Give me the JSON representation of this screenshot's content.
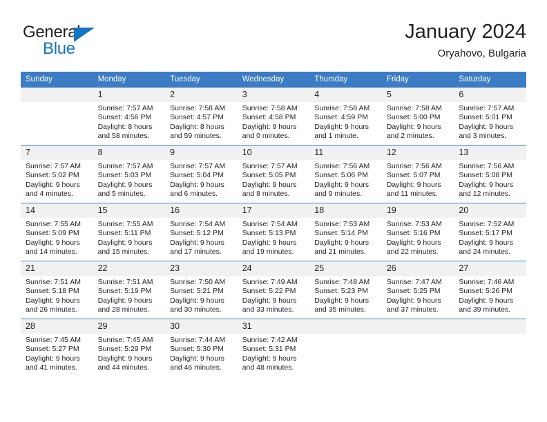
{
  "brand": {
    "name_top": "General",
    "name_bottom": "Blue",
    "accent_color": "#1273c4"
  },
  "header": {
    "title": "January 2024",
    "subtitle": "Oryahovo, Bulgaria"
  },
  "theme": {
    "header_row_color": "#3b7cc4",
    "daynum_bg": "#f1f1f1",
    "text_color": "#231f20"
  },
  "weekdays": [
    "Sunday",
    "Monday",
    "Tuesday",
    "Wednesday",
    "Thursday",
    "Friday",
    "Saturday"
  ],
  "weeks": [
    [
      {
        "day": "",
        "sunrise": "",
        "sunset": "",
        "daylight_line1": "",
        "daylight_line2": "",
        "empty": true
      },
      {
        "day": "1",
        "sunrise": "Sunrise: 7:57 AM",
        "sunset": "Sunset: 4:56 PM",
        "daylight_line1": "Daylight: 8 hours",
        "daylight_line2": "and 58 minutes."
      },
      {
        "day": "2",
        "sunrise": "Sunrise: 7:58 AM",
        "sunset": "Sunset: 4:57 PM",
        "daylight_line1": "Daylight: 8 hours",
        "daylight_line2": "and 59 minutes."
      },
      {
        "day": "3",
        "sunrise": "Sunrise: 7:58 AM",
        "sunset": "Sunset: 4:58 PM",
        "daylight_line1": "Daylight: 9 hours",
        "daylight_line2": "and 0 minutes."
      },
      {
        "day": "4",
        "sunrise": "Sunrise: 7:58 AM",
        "sunset": "Sunset: 4:59 PM",
        "daylight_line1": "Daylight: 9 hours",
        "daylight_line2": "and 1 minute."
      },
      {
        "day": "5",
        "sunrise": "Sunrise: 7:58 AM",
        "sunset": "Sunset: 5:00 PM",
        "daylight_line1": "Daylight: 9 hours",
        "daylight_line2": "and 2 minutes."
      },
      {
        "day": "6",
        "sunrise": "Sunrise: 7:57 AM",
        "sunset": "Sunset: 5:01 PM",
        "daylight_line1": "Daylight: 9 hours",
        "daylight_line2": "and 3 minutes."
      }
    ],
    [
      {
        "day": "7",
        "sunrise": "Sunrise: 7:57 AM",
        "sunset": "Sunset: 5:02 PM",
        "daylight_line1": "Daylight: 9 hours",
        "daylight_line2": "and 4 minutes."
      },
      {
        "day": "8",
        "sunrise": "Sunrise: 7:57 AM",
        "sunset": "Sunset: 5:03 PM",
        "daylight_line1": "Daylight: 9 hours",
        "daylight_line2": "and 5 minutes."
      },
      {
        "day": "9",
        "sunrise": "Sunrise: 7:57 AM",
        "sunset": "Sunset: 5:04 PM",
        "daylight_line1": "Daylight: 9 hours",
        "daylight_line2": "and 6 minutes."
      },
      {
        "day": "10",
        "sunrise": "Sunrise: 7:57 AM",
        "sunset": "Sunset: 5:05 PM",
        "daylight_line1": "Daylight: 9 hours",
        "daylight_line2": "and 8 minutes."
      },
      {
        "day": "11",
        "sunrise": "Sunrise: 7:56 AM",
        "sunset": "Sunset: 5:06 PM",
        "daylight_line1": "Daylight: 9 hours",
        "daylight_line2": "and 9 minutes."
      },
      {
        "day": "12",
        "sunrise": "Sunrise: 7:56 AM",
        "sunset": "Sunset: 5:07 PM",
        "daylight_line1": "Daylight: 9 hours",
        "daylight_line2": "and 11 minutes."
      },
      {
        "day": "13",
        "sunrise": "Sunrise: 7:56 AM",
        "sunset": "Sunset: 5:08 PM",
        "daylight_line1": "Daylight: 9 hours",
        "daylight_line2": "and 12 minutes."
      }
    ],
    [
      {
        "day": "14",
        "sunrise": "Sunrise: 7:55 AM",
        "sunset": "Sunset: 5:09 PM",
        "daylight_line1": "Daylight: 9 hours",
        "daylight_line2": "and 14 minutes."
      },
      {
        "day": "15",
        "sunrise": "Sunrise: 7:55 AM",
        "sunset": "Sunset: 5:11 PM",
        "daylight_line1": "Daylight: 9 hours",
        "daylight_line2": "and 15 minutes."
      },
      {
        "day": "16",
        "sunrise": "Sunrise: 7:54 AM",
        "sunset": "Sunset: 5:12 PM",
        "daylight_line1": "Daylight: 9 hours",
        "daylight_line2": "and 17 minutes."
      },
      {
        "day": "17",
        "sunrise": "Sunrise: 7:54 AM",
        "sunset": "Sunset: 5:13 PM",
        "daylight_line1": "Daylight: 9 hours",
        "daylight_line2": "and 19 minutes."
      },
      {
        "day": "18",
        "sunrise": "Sunrise: 7:53 AM",
        "sunset": "Sunset: 5:14 PM",
        "daylight_line1": "Daylight: 9 hours",
        "daylight_line2": "and 21 minutes."
      },
      {
        "day": "19",
        "sunrise": "Sunrise: 7:53 AM",
        "sunset": "Sunset: 5:16 PM",
        "daylight_line1": "Daylight: 9 hours",
        "daylight_line2": "and 22 minutes."
      },
      {
        "day": "20",
        "sunrise": "Sunrise: 7:52 AM",
        "sunset": "Sunset: 5:17 PM",
        "daylight_line1": "Daylight: 9 hours",
        "daylight_line2": "and 24 minutes."
      }
    ],
    [
      {
        "day": "21",
        "sunrise": "Sunrise: 7:51 AM",
        "sunset": "Sunset: 5:18 PM",
        "daylight_line1": "Daylight: 9 hours",
        "daylight_line2": "and 26 minutes."
      },
      {
        "day": "22",
        "sunrise": "Sunrise: 7:51 AM",
        "sunset": "Sunset: 5:19 PM",
        "daylight_line1": "Daylight: 9 hours",
        "daylight_line2": "and 28 minutes."
      },
      {
        "day": "23",
        "sunrise": "Sunrise: 7:50 AM",
        "sunset": "Sunset: 5:21 PM",
        "daylight_line1": "Daylight: 9 hours",
        "daylight_line2": "and 30 minutes."
      },
      {
        "day": "24",
        "sunrise": "Sunrise: 7:49 AM",
        "sunset": "Sunset: 5:22 PM",
        "daylight_line1": "Daylight: 9 hours",
        "daylight_line2": "and 33 minutes."
      },
      {
        "day": "25",
        "sunrise": "Sunrise: 7:48 AM",
        "sunset": "Sunset: 5:23 PM",
        "daylight_line1": "Daylight: 9 hours",
        "daylight_line2": "and 35 minutes."
      },
      {
        "day": "26",
        "sunrise": "Sunrise: 7:47 AM",
        "sunset": "Sunset: 5:25 PM",
        "daylight_line1": "Daylight: 9 hours",
        "daylight_line2": "and 37 minutes."
      },
      {
        "day": "27",
        "sunrise": "Sunrise: 7:46 AM",
        "sunset": "Sunset: 5:26 PM",
        "daylight_line1": "Daylight: 9 hours",
        "daylight_line2": "and 39 minutes."
      }
    ],
    [
      {
        "day": "28",
        "sunrise": "Sunrise: 7:45 AM",
        "sunset": "Sunset: 5:27 PM",
        "daylight_line1": "Daylight: 9 hours",
        "daylight_line2": "and 41 minutes."
      },
      {
        "day": "29",
        "sunrise": "Sunrise: 7:45 AM",
        "sunset": "Sunset: 5:29 PM",
        "daylight_line1": "Daylight: 9 hours",
        "daylight_line2": "and 44 minutes."
      },
      {
        "day": "30",
        "sunrise": "Sunrise: 7:44 AM",
        "sunset": "Sunset: 5:30 PM",
        "daylight_line1": "Daylight: 9 hours",
        "daylight_line2": "and 46 minutes."
      },
      {
        "day": "31",
        "sunrise": "Sunrise: 7:42 AM",
        "sunset": "Sunset: 5:31 PM",
        "daylight_line1": "Daylight: 9 hours",
        "daylight_line2": "and 48 minutes."
      },
      {
        "day": "",
        "sunrise": "",
        "sunset": "",
        "daylight_line1": "",
        "daylight_line2": "",
        "empty": true
      },
      {
        "day": "",
        "sunrise": "",
        "sunset": "",
        "daylight_line1": "",
        "daylight_line2": "",
        "empty": true
      },
      {
        "day": "",
        "sunrise": "",
        "sunset": "",
        "daylight_line1": "",
        "daylight_line2": "",
        "empty": true
      }
    ]
  ]
}
